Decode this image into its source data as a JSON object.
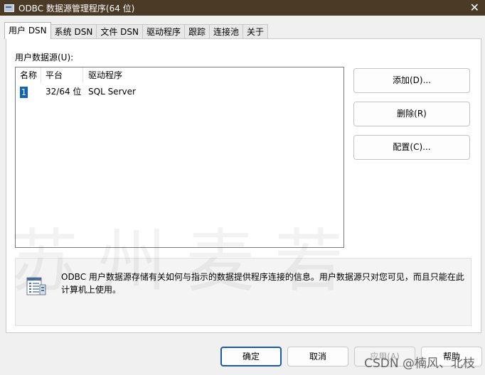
{
  "window": {
    "title": "ODBC 数据源管理程序(64 位)",
    "close_glyph": "✕"
  },
  "tabs": [
    {
      "label": "用户 DSN",
      "active": true
    },
    {
      "label": "系统 DSN",
      "active": false
    },
    {
      "label": "文件 DSN",
      "active": false
    },
    {
      "label": "驱动程序",
      "active": false
    },
    {
      "label": "跟踪",
      "active": false
    },
    {
      "label": "连接池",
      "active": false
    },
    {
      "label": "关于",
      "active": false
    }
  ],
  "panel": {
    "list_label": "用户数据源(U):",
    "columns": [
      "名称",
      "平台",
      "驱动程序"
    ],
    "rows": [
      {
        "name": "1",
        "platform": "32/64 位",
        "driver": "SQL Server"
      }
    ],
    "side_buttons": {
      "add": "添加(D)...",
      "remove": "删除(R)",
      "configure": "配置(C)..."
    },
    "info_text": "ODBC 用户数据源存储有关如何与指示的数据提供程序连接的信息。用户数据源只对您可见，而且只能在此计算机上使用。"
  },
  "footer": {
    "ok": "确定",
    "cancel": "取消",
    "apply": "应用(A)",
    "help": "帮助"
  },
  "watermark": {
    "main": "苏州麦若",
    "csdn": "CSDN @楠风、北枝"
  },
  "colors": {
    "titlebar": "#4a3a26",
    "selection": "#0f64b4",
    "default_button_border": "#1c5aa0"
  }
}
